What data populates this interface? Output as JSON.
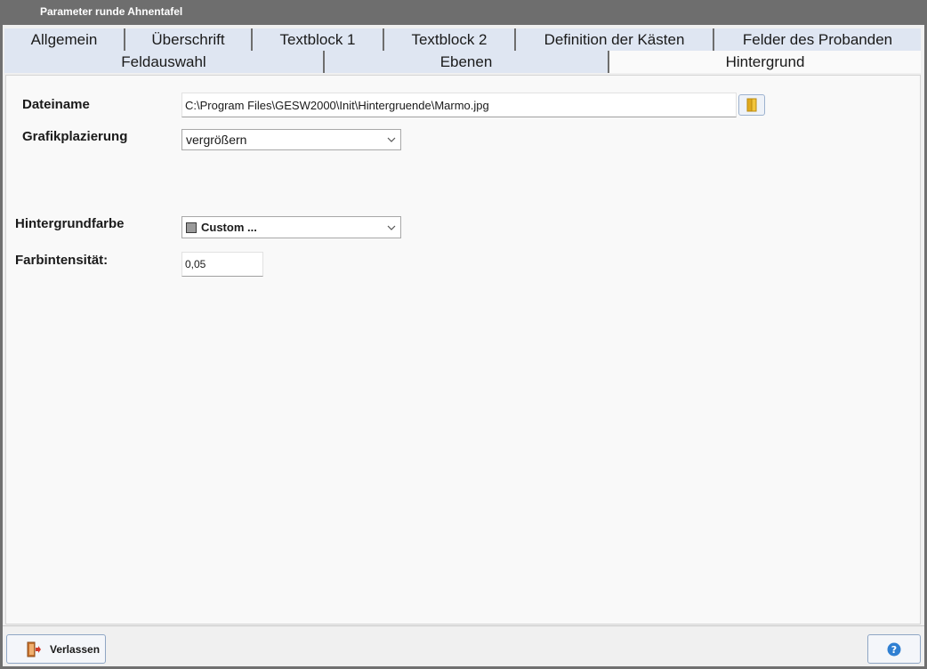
{
  "window": {
    "title": "Parameter runde Ahnentafel"
  },
  "tabs_row1": [
    {
      "label": "Allgemein"
    },
    {
      "label": "Überschrift"
    },
    {
      "label": "Textblock 1"
    },
    {
      "label": "Textblock 2"
    },
    {
      "label": "Definition der Kästen"
    },
    {
      "label": "Felder des Probanden"
    }
  ],
  "tabs_row2": [
    {
      "label": "Feldauswahl"
    },
    {
      "label": "Ebenen"
    },
    {
      "label": "Hintergrund",
      "active": true
    }
  ],
  "form": {
    "dateiname_label": "Dateiname",
    "dateiname_value": "C:\\Program Files\\GESW2000\\Init\\Hintergruende\\Marmo.jpg",
    "grafikplazierung_label": "Grafikplazierung",
    "grafikplazierung_value": "vergrößern",
    "hintergrundfarbe_label": "Hintergrundfarbe",
    "hintergrundfarbe_value": "Custom ...",
    "farbintensitaet_label": "Farbintensität:",
    "farbintensitaet_value": "0,05"
  },
  "buttons": {
    "exit_label": "Verlassen"
  },
  "icons": {
    "browse": "folder-icon",
    "exit": "door-exit-icon",
    "help": "help-icon"
  },
  "colors": {
    "tab_bg": "#dfe6f2",
    "active_tab_bg": "#fafafa",
    "swatch": "#9a9a9a",
    "help_blue": "#2f7fd2"
  }
}
